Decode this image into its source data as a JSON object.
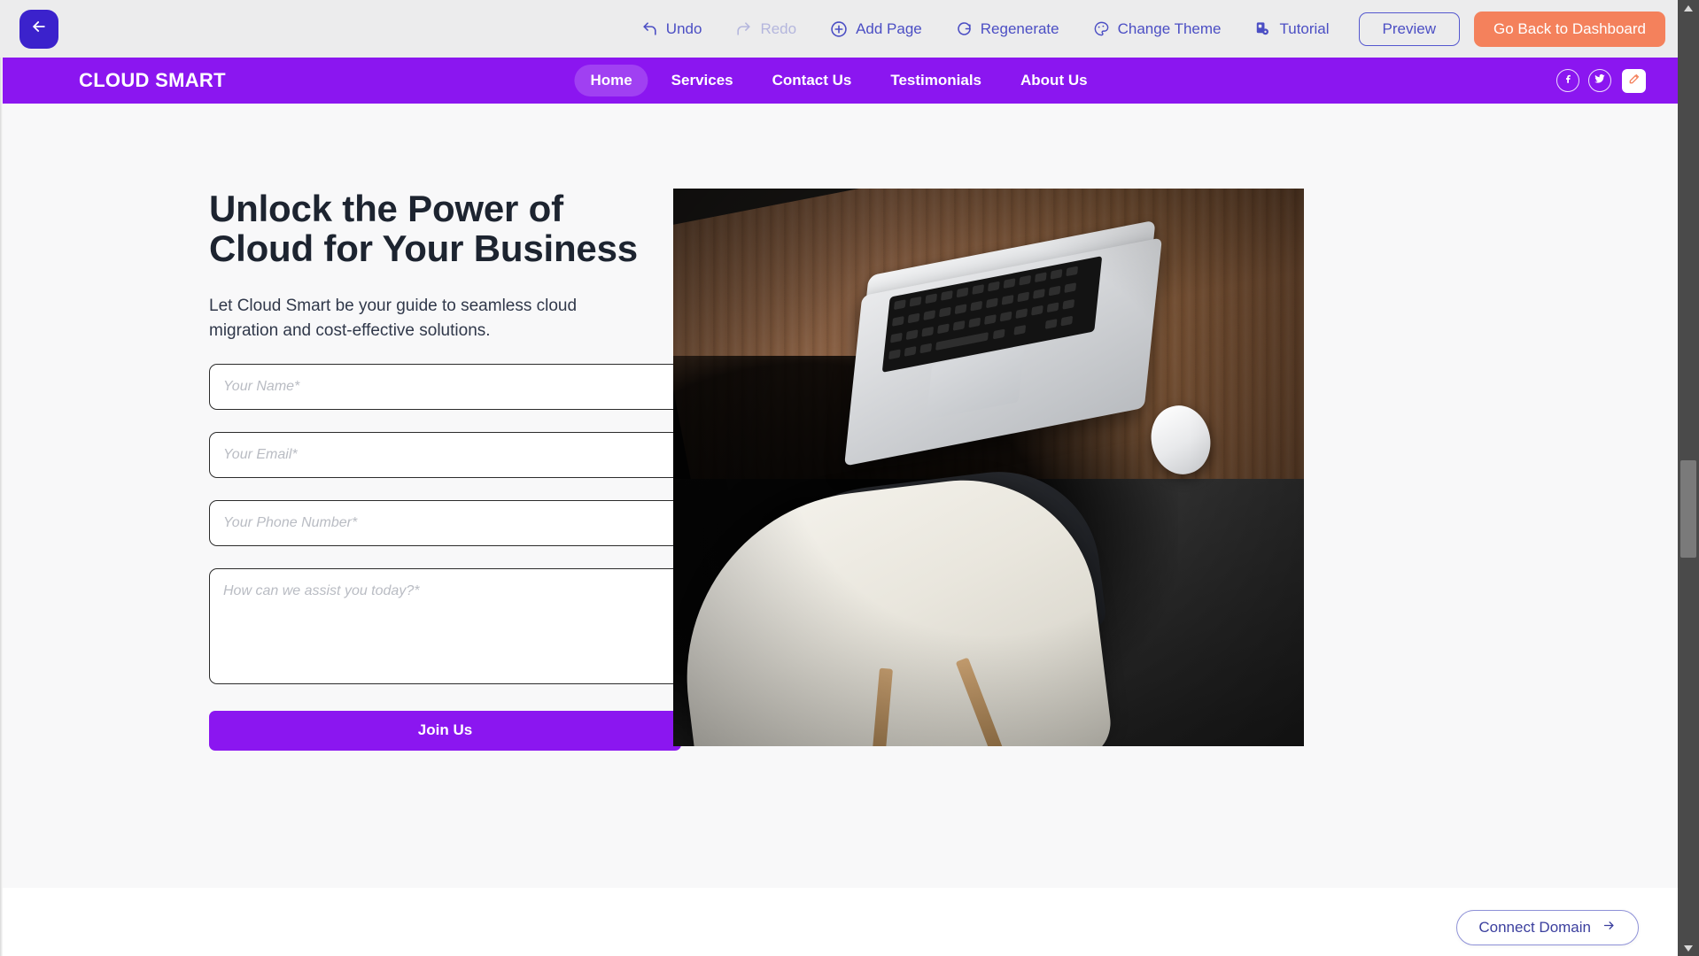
{
  "builder_toolbar": {
    "back_button": "back-arrow-icon",
    "items": [
      {
        "label": "Undo",
        "icon": "undo-icon",
        "disabled": false
      },
      {
        "label": "Redo",
        "icon": "redo-icon",
        "disabled": true
      },
      {
        "label": "Add Page",
        "icon": "plus-circle-icon",
        "disabled": false
      },
      {
        "label": "Regenerate",
        "icon": "refresh-icon",
        "disabled": false
      },
      {
        "label": "Change Theme",
        "icon": "palette-icon",
        "disabled": false
      },
      {
        "label": "Tutorial",
        "icon": "tutorial-icon",
        "disabled": false
      }
    ],
    "preview_label": "Preview",
    "dashboard_label": "Go Back to Dashboard",
    "colors": {
      "bar_bg": "#ececed",
      "link": "#4b4ec4",
      "link_disabled": "#b4b6dd",
      "dashboard_bg": "#f4815c",
      "back_bg": "#3b22cc"
    }
  },
  "site": {
    "logo": "CLOUD SMART",
    "nav_links": [
      {
        "label": "Home",
        "active": true
      },
      {
        "label": "Services",
        "active": false
      },
      {
        "label": "Contact Us",
        "active": false
      },
      {
        "label": "Testimonials",
        "active": false
      },
      {
        "label": "About Us",
        "active": false
      }
    ],
    "social": [
      {
        "name": "facebook-icon"
      },
      {
        "name": "twitter-icon"
      }
    ],
    "edit_badge": "edit-pencil-icon",
    "hero": {
      "title": "Unlock the Power of Cloud for Your Business",
      "subtitle": "Let Cloud Smart be your guide to seamless cloud migration and cost-effective solutions.",
      "form": {
        "name_placeholder": "Your Name*",
        "name_value": "",
        "email_placeholder": "Your Email*",
        "email_value": "",
        "phone_placeholder": "Your Phone Number*",
        "phone_value": "",
        "message_placeholder": "How can we assist you today?*",
        "message_value": "",
        "submit_label": "Join Us",
        "autofill_badge": "bot-icon"
      },
      "image_alt": "laptop-on-wooden-desk-with-mouse-and-chair"
    },
    "colors": {
      "brand_purple": "#8b16f0",
      "page_bg": "#f8f8f9",
      "heading": "#1d2430",
      "field_border": "#2b2b2b",
      "placeholder": "#b9bcc3"
    }
  },
  "connect_domain": {
    "label": "Connect Domain",
    "icon": "arrow-right-icon"
  },
  "scrollbar": {
    "up_arrow": "scroll-up-arrow-icon",
    "down_arrow": "scroll-down-arrow-icon"
  }
}
